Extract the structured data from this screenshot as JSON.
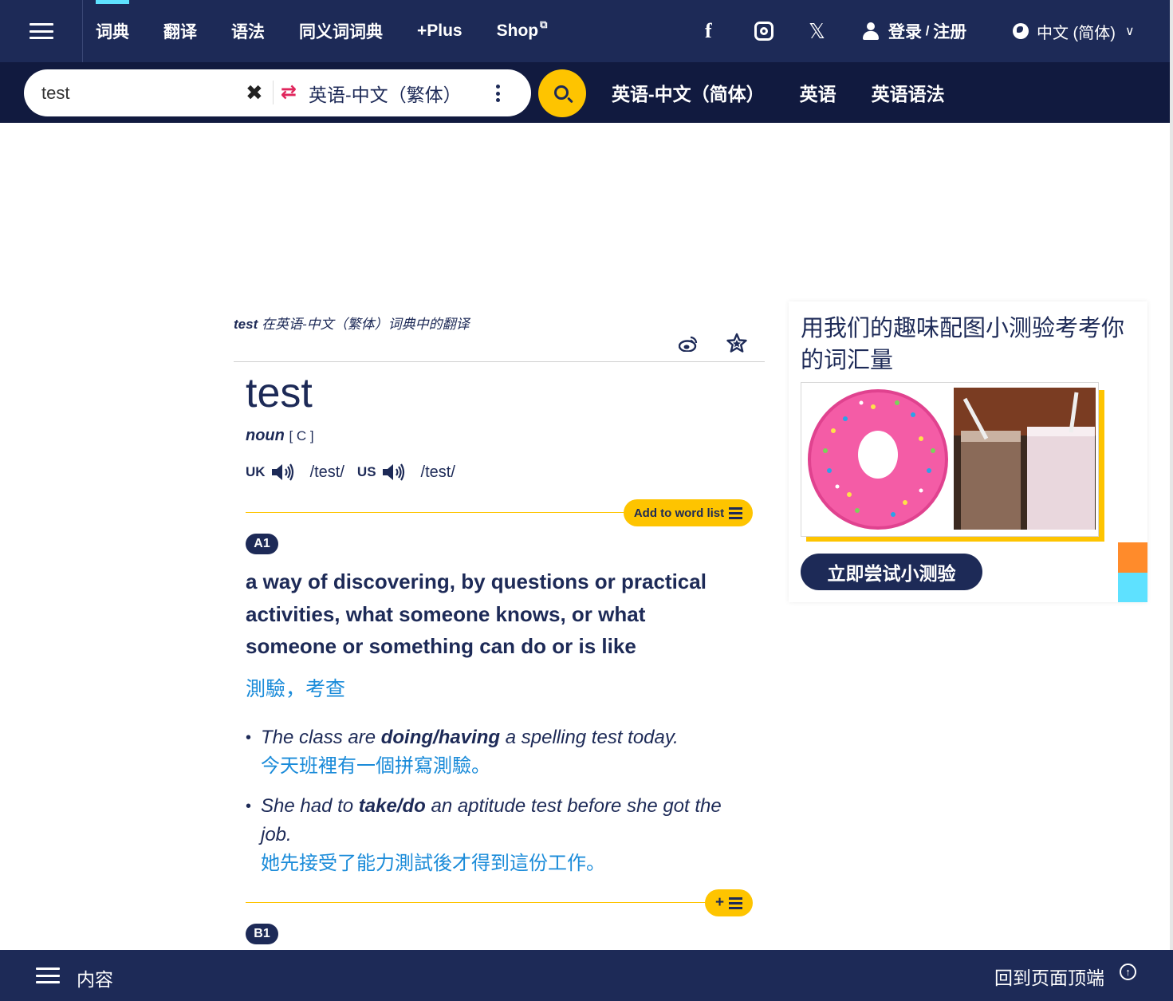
{
  "topnav": {
    "items": [
      {
        "label": "词典",
        "active": true
      },
      {
        "label": "翻译"
      },
      {
        "label": "语法"
      },
      {
        "label": "同义词词典"
      },
      {
        "label": "+Plus"
      },
      {
        "label": "Shop",
        "external": true
      }
    ],
    "social": [
      "facebook-icon",
      "instagram-icon",
      "x-icon"
    ],
    "login_label": "登录",
    "login_sep": " / ",
    "register_label": "注册",
    "language_label": "中文 (简体)"
  },
  "search": {
    "value": "test",
    "dictionary": "英语-中文（繁体）",
    "quick_links": [
      "英语-中文（简体）",
      "英语",
      "英语语法"
    ]
  },
  "entry": {
    "heading_word": "test",
    "heading_suffix": " 在英语-中文（繁体）词典中的翻译",
    "headword": "test",
    "pos": "noun",
    "grammar": "[ C ]",
    "uk_label": "UK",
    "uk_ipa": "/test/",
    "us_label": "US",
    "us_ipa": "/test/",
    "add_to_list": "Add to word list",
    "add_small": "+",
    "senses": [
      {
        "level": "A1",
        "definition": "a way of discovering, by questions or practical activities, what someone knows, or what someone or something can do or is like",
        "translation": "測驗，考查",
        "examples": [
          {
            "pre": "The class are ",
            "bold": "doing/having",
            "post": " a spelling test today.",
            "translation": "今天班裡有一個拼寫測驗。"
          },
          {
            "pre": "She had to ",
            "bold": "take/do",
            "post": " an aptitude test before she got the job.",
            "translation": "她先接受了能力測試後才得到這份工作。"
          }
        ]
      },
      {
        "level": "B1"
      }
    ]
  },
  "promo": {
    "title": "用我们的趣味配图小测验考考你的词汇量",
    "button": "立即尝试小测验"
  },
  "footer": {
    "contents_label": "内容",
    "back_to_top": "回到页面顶端"
  },
  "colors": {
    "navy": "#1d2a57",
    "dark_navy": "#111a3f",
    "gold": "#fec400",
    "link_blue": "#1a8bd9",
    "cyan": "#5ee1ff",
    "orange": "#ff8b2b"
  }
}
